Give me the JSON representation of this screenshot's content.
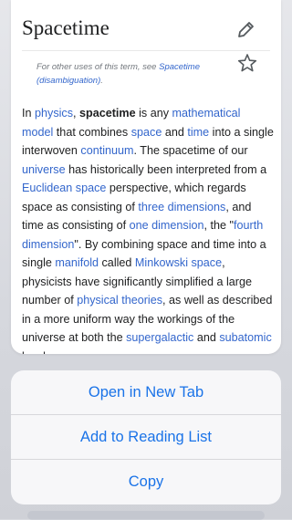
{
  "article": {
    "title": "Spacetime",
    "hatnote_prefix": "For other uses of this term, see ",
    "hatnote_link": "Spacetime (disambiguation)",
    "hatnote_suffix": ".",
    "body": [
      {
        "t": "In "
      },
      {
        "l": "physics"
      },
      {
        "t": ", "
      },
      {
        "b": "spacetime"
      },
      {
        "t": " is any "
      },
      {
        "l": "mathematical model"
      },
      {
        "t": " that combines "
      },
      {
        "l": "space"
      },
      {
        "t": " and "
      },
      {
        "l": "time"
      },
      {
        "t": " into a single interwoven "
      },
      {
        "l": "continuum"
      },
      {
        "t": ". The spacetime of our "
      },
      {
        "l": "universe"
      },
      {
        "t": " has historically been interpreted from a "
      },
      {
        "l": "Euclidean space"
      },
      {
        "t": " perspective, which regards space as consisting of "
      },
      {
        "l": "three dimensions"
      },
      {
        "t": ", and time as consisting of "
      },
      {
        "l": "one dimension"
      },
      {
        "t": ", the \""
      },
      {
        "l": "fourth dimension"
      },
      {
        "t": "\". By combining space and time into a single "
      },
      {
        "l": "manifold"
      },
      {
        "t": " called "
      },
      {
        "l": "Minkowski space"
      },
      {
        "t": ", physicists have significantly simplified a large number of "
      },
      {
        "l": "physical theories"
      },
      {
        "t": ", as well as described in a more uniform way the workings of the universe at both the "
      },
      {
        "l": "supergalactic"
      },
      {
        "t": " and "
      },
      {
        "l": "subatomic"
      },
      {
        "t": " levels."
      }
    ]
  },
  "icons": {
    "edit": "pencil-icon",
    "save": "star-icon"
  },
  "sheet": {
    "items": [
      "Open in New Tab",
      "Add to Reading List",
      "Copy"
    ]
  },
  "colors": {
    "link": "#3366cc",
    "action": "#1a73e8"
  }
}
